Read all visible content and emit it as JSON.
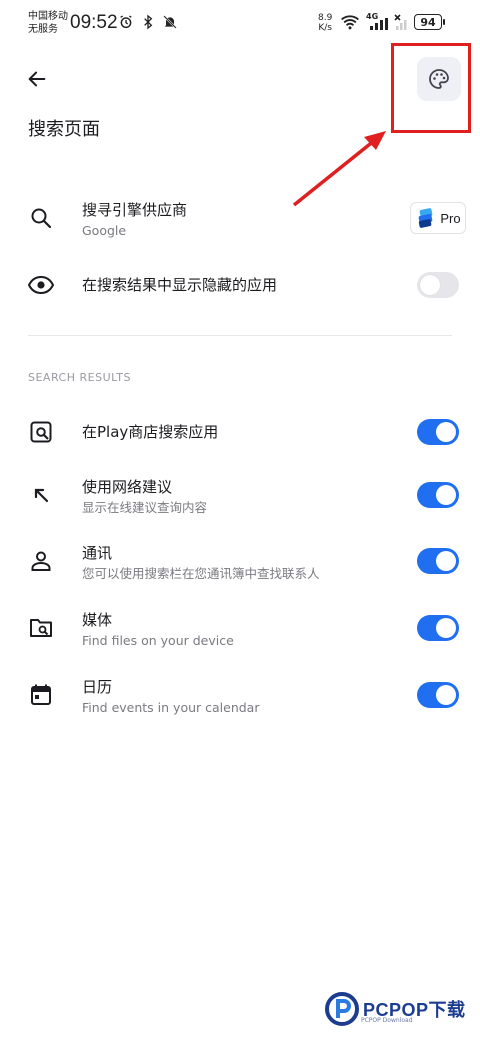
{
  "status_bar": {
    "carrier_line1": "中国移动",
    "carrier_line2": "无服务",
    "time": "09:52",
    "net_speed_value": "8.9",
    "net_speed_unit": "K/s",
    "network_type": "4G",
    "battery": "94",
    "icons_left": [
      "alarm-icon",
      "bluetooth-icon",
      "mute-bell-icon"
    ],
    "icons_right": [
      "wifi-icon",
      "signal-icon",
      "no-signal-icon"
    ]
  },
  "header": {
    "back_icon": "arrow-left-icon",
    "palette_icon": "palette-icon",
    "title": "搜索页面"
  },
  "settings": [
    {
      "id": "provider",
      "icon": "search-icon",
      "label": "搜寻引擎供应商",
      "sub": "Google",
      "control": "pro-badge"
    },
    {
      "id": "hidden-apps",
      "icon": "eye-icon",
      "label": "在搜索结果中显示隐藏的应用",
      "sub": "",
      "control": "toggle",
      "on": false
    }
  ],
  "pro_badge": {
    "label": "Pro"
  },
  "section": {
    "title": "SEARCH RESULTS"
  },
  "results": [
    {
      "id": "play-store",
      "icon": "store-search-icon",
      "label": "在Play商店搜索应用",
      "sub": "",
      "on": true
    },
    {
      "id": "web-suggest",
      "icon": "arrow-up-left-icon",
      "label": "使用网络建议",
      "sub": "显示在线建议查询内容",
      "on": true
    },
    {
      "id": "contacts",
      "icon": "person-icon",
      "label": "通讯",
      "sub": "您可以使用搜索栏在您通讯簿中查找联系人",
      "on": true
    },
    {
      "id": "media",
      "icon": "folder-search-icon",
      "label": "媒体",
      "sub": "Find files on your device",
      "on": true
    },
    {
      "id": "calendar",
      "icon": "calendar-icon",
      "label": "日历",
      "sub": "Find events in your calendar",
      "on": true
    }
  ],
  "colors": {
    "accent": "#1f6ff0",
    "annotation": "#e02020",
    "toggle_off": "#e6e6ea"
  },
  "watermark": {
    "text": "PCPOP下载",
    "sub": "PCPOP Download"
  }
}
